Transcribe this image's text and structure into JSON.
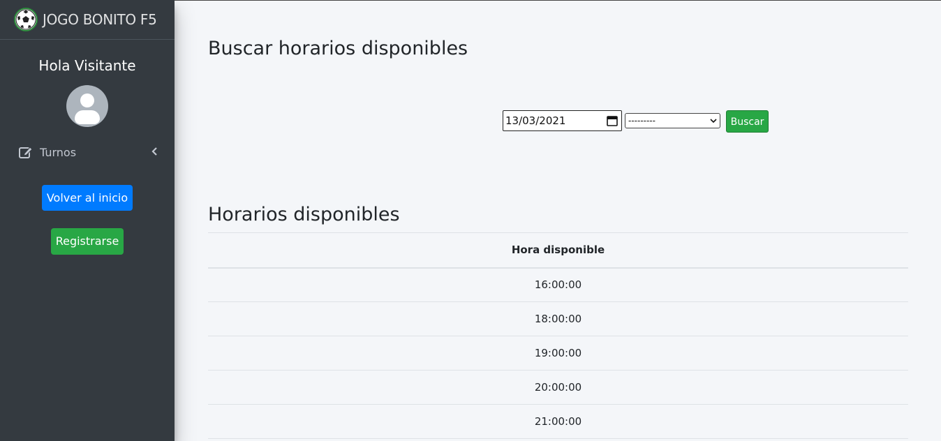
{
  "brand": {
    "name": "JOGO BONITO F5",
    "logo_icon": "soccer-ball-icon"
  },
  "sidebar": {
    "greeting": "Hola Visitante",
    "avatar_icon": "user-avatar-icon",
    "nav_items": [
      {
        "label": "Turnos",
        "icon": "edit-icon"
      }
    ],
    "buttons": {
      "volver": "Volver al inicio",
      "registrarse": "Registrarse"
    }
  },
  "search": {
    "title": "Buscar horarios disponibles",
    "date_value": "13/03/2021",
    "select_value": "---------",
    "button_label": "Buscar"
  },
  "results": {
    "title": "Horarios disponibles",
    "column_header": "Hora disponible",
    "rows": [
      "16:00:00",
      "18:00:00",
      "19:00:00",
      "20:00:00",
      "21:00:00"
    ]
  },
  "colors": {
    "sidebar": "#343a40",
    "primary": "#007bff",
    "success": "#28a745",
    "background": "#f4f6f9"
  }
}
